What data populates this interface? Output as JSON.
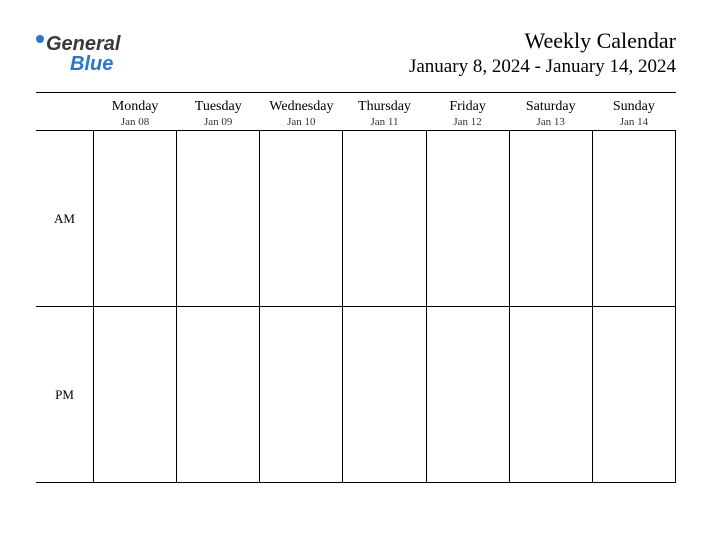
{
  "logo": {
    "part1": "General",
    "part2": "Blue"
  },
  "title": "Weekly Calendar",
  "subtitle": "January 8, 2024 - January 14, 2024",
  "periods": [
    "AM",
    "PM"
  ],
  "days": [
    {
      "name": "Monday",
      "date": "Jan 08"
    },
    {
      "name": "Tuesday",
      "date": "Jan 09"
    },
    {
      "name": "Wednesday",
      "date": "Jan 10"
    },
    {
      "name": "Thursday",
      "date": "Jan 11"
    },
    {
      "name": "Friday",
      "date": "Jan 12"
    },
    {
      "name": "Saturday",
      "date": "Jan 13"
    },
    {
      "name": "Sunday",
      "date": "Jan 14"
    }
  ]
}
